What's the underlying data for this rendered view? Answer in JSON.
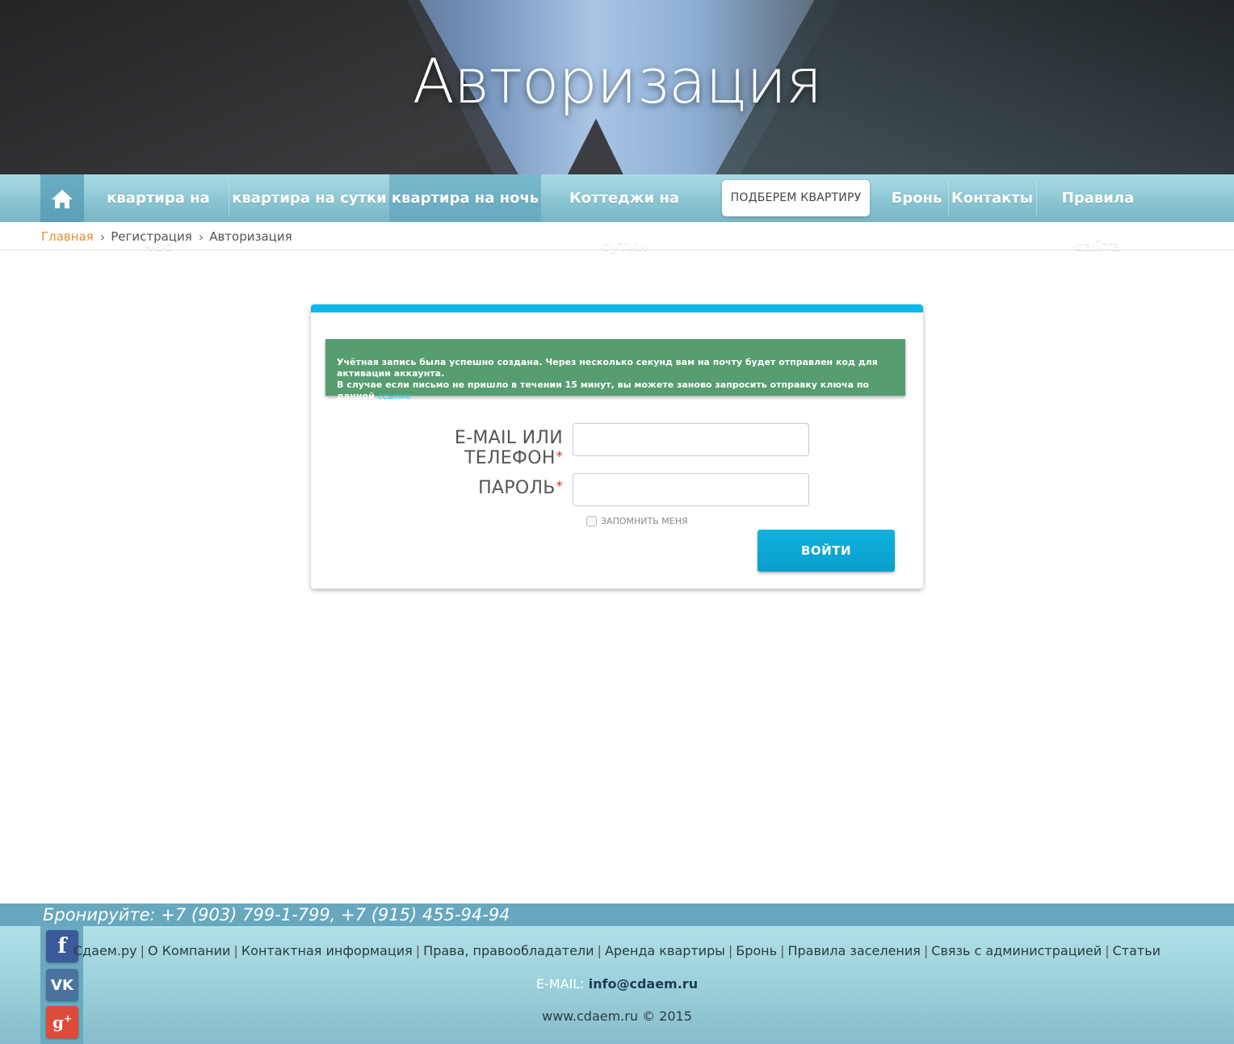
{
  "hero": {
    "title": "Авторизация"
  },
  "nav": {
    "home_icon": "home-icon",
    "items": [
      {
        "label": "квартира на час"
      },
      {
        "label": "квартира на сутки"
      },
      {
        "label": "квартира на ночь",
        "active": true
      },
      {
        "label": "Коттеджи на сутки"
      },
      {
        "label": "Бронь"
      },
      {
        "label": "Контакты"
      },
      {
        "label": "Правила сайта"
      }
    ],
    "pick_button": "ПОДБЕРЕМ КВАРТИРУ"
  },
  "breadcrumb": {
    "items": [
      "Главная",
      "Регистрация",
      "Авторизация"
    ]
  },
  "alert": {
    "line1": "Учётная запись была успешно создана. Через несколько секунд вам на почту будет отправлен код для активации аккаунта.",
    "line2": "В случае если письмо не пришло в течении 15 минут, вы можете заново запросить отправку ключа по данной",
    "link": "ссылке"
  },
  "form": {
    "email_label": "E-MAIL ИЛИ ТЕЛЕФОН",
    "password_label": "ПАРОЛЬ",
    "required_mark": "*",
    "email_value": "",
    "password_value": "",
    "remember_label": "ЗАПОМНИТЬ МЕНЯ",
    "remember_checked": false,
    "submit_label": "ВОЙТИ"
  },
  "footer": {
    "phone_line": "Бронируйте: +7 (903) 799-1-799, +7 (915) 455-94-94",
    "social": [
      "facebook-icon",
      "vk-icon",
      "google-plus-icon"
    ],
    "links": [
      "Сдаем.ру",
      "О Компании",
      "Контактная информация",
      "Права, правообладатели",
      "Аренда квартиры",
      "Бронь",
      "Правила заселения",
      "Связь с администрацией",
      "Статьи"
    ],
    "email_label": "E-MAIL:",
    "email_value": "info@cdaem.ru",
    "copyright": "www.cdaem.ru © 2015"
  },
  "colors": {
    "accent": "#0ab9ea",
    "alert_bg": "#569d6f",
    "nav_bg": "#8cc6d3",
    "breadcrumb_home": "#e8922c"
  }
}
